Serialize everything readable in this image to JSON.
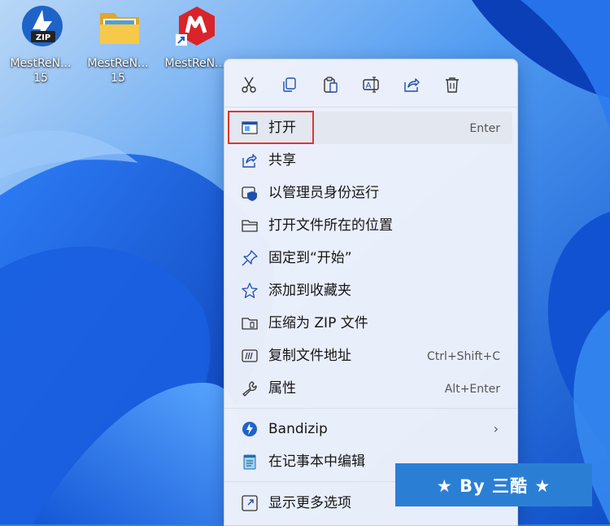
{
  "desktop": {
    "icons": [
      {
        "name": "MestReN...",
        "subtitle": "15",
        "icon": "zip-archive-icon"
      },
      {
        "name": "MestReN...",
        "subtitle": "15",
        "icon": "folder-icon"
      },
      {
        "name": "MestReN...",
        "subtitle": "",
        "icon": "mestrenova-shortcut-icon"
      }
    ]
  },
  "quick_actions": {
    "items": [
      {
        "icon": "cut-icon"
      },
      {
        "icon": "copy-icon"
      },
      {
        "icon": "paste-icon"
      },
      {
        "icon": "rename-icon"
      },
      {
        "icon": "share-icon"
      },
      {
        "icon": "delete-icon"
      }
    ]
  },
  "menu": {
    "items": [
      {
        "label": "打开",
        "shortcut": "Enter",
        "icon": "open-window-icon"
      },
      {
        "label": "共享",
        "shortcut": "",
        "icon": "share-icon"
      },
      {
        "label": "以管理员身份运行",
        "shortcut": "",
        "icon": "admin-shield-icon"
      },
      {
        "label": "打开文件所在的位置",
        "shortcut": "",
        "icon": "folder-outline-icon"
      },
      {
        "label": "固定到“开始”",
        "shortcut": "",
        "icon": "pin-icon"
      },
      {
        "label": "添加到收藏夹",
        "shortcut": "",
        "icon": "star-icon"
      },
      {
        "label": "压缩为 ZIP 文件",
        "shortcut": "",
        "icon": "zip-file-icon"
      },
      {
        "label": "复制文件地址",
        "shortcut": "Ctrl+Shift+C",
        "icon": "copy-path-icon"
      },
      {
        "label": "属性",
        "shortcut": "Alt+Enter",
        "icon": "wrench-icon"
      },
      {
        "label": "Bandizip",
        "shortcut": "",
        "icon": "bandizip-icon"
      },
      {
        "label": "在记事本中编辑",
        "shortcut": "",
        "icon": "notepad-icon"
      },
      {
        "label": "显示更多选项",
        "shortcut": "",
        "icon": "more-options-icon"
      }
    ]
  },
  "watermark": {
    "text": "★ By 三酷 ★"
  },
  "colors": {
    "accent": "#2a7fd5",
    "highlight_border": "#e23434",
    "menu_bg": "#eef2fb"
  }
}
